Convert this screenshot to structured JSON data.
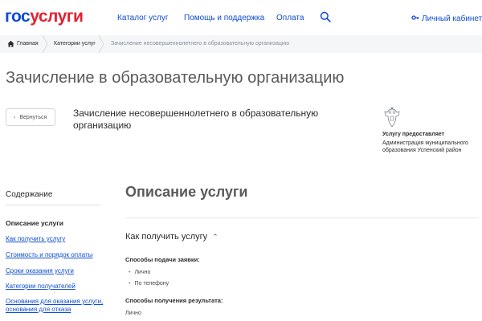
{
  "header": {
    "logo_part1": "гос",
    "logo_part2": "услуги",
    "nav": [
      "Каталог услуг",
      "Помощь и поддержка",
      "Оплата"
    ],
    "cabinet_label": "Личный кабинет",
    "icons": {
      "search": "search-icon",
      "cabinet": "key-icon"
    },
    "colors": {
      "brand_blue": "#0d4cd3",
      "brand_red": "#e4202f"
    }
  },
  "breadcrumb": {
    "home": "Главная",
    "category": "Категории услуг",
    "current": "Зачисление несовершеннолетнего в образовательную организацию"
  },
  "page": {
    "title": "Зачисление в образовательную организацию",
    "back_label": "Вернуться",
    "service_title": "Зачисление несовершеннолетнего в образовательную организацию"
  },
  "provider": {
    "label": "Услугу предоставляет",
    "name": "Администрация муниципального образования Успенский район"
  },
  "toc": {
    "title": "Содержание",
    "active": "Описание услуги",
    "links": [
      "Как получить услугу",
      "Стоимость и порядок оплаты",
      "Сроки оказания услуги",
      "Категории получателей",
      "Основания для оказания услуги,",
      "основания для отказа"
    ]
  },
  "content": {
    "section_title": "Описание услуги",
    "accordion_title": "Как получить услугу",
    "submission_heading": "Способы подачи заявки:",
    "submission_methods": [
      "Лично",
      "По телефону"
    ],
    "result_heading": "Способы получения результата:",
    "result_methods": [
      "Лично"
    ]
  }
}
